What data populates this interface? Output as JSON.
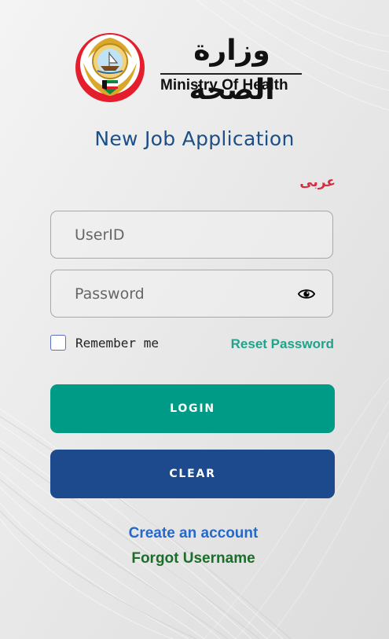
{
  "branding": {
    "name_ar": "وزارة الصحة",
    "name_en": "Ministry Of Health",
    "emblem_icon": "kuwait-emblem-icon"
  },
  "page": {
    "title": "New Job Application",
    "language_toggle": "عربى"
  },
  "form": {
    "userid_placeholder": "UserID",
    "password_placeholder": "Password",
    "show_password_icon": "eye-icon",
    "remember_label": "Remember me",
    "remember_checked": false,
    "reset_password": "Reset Password"
  },
  "buttons": {
    "login": "LOGIN",
    "clear": "CLEAR"
  },
  "links": {
    "create_account": "Create an account",
    "forgot_username": "Forgot Username"
  },
  "colors": {
    "title": "#1d4f87",
    "language_toggle": "#d32f3f",
    "reset_password": "#1fa38a",
    "login_button": "#009b87",
    "clear_button": "#1c4a8c",
    "create_account": "#2669c9",
    "forgot_username": "#1d6d2a"
  }
}
